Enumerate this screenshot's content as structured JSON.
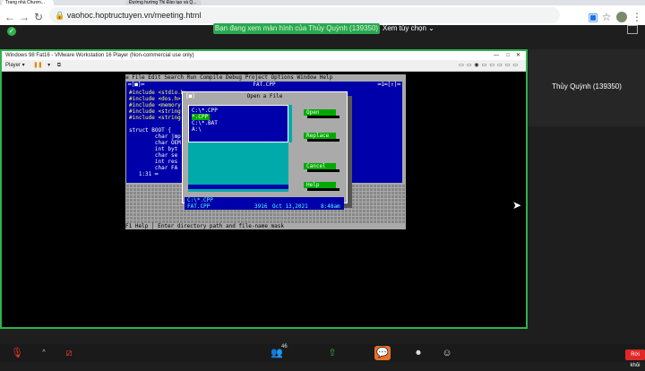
{
  "browser": {
    "url": "vaohoc.hoptructuyen.vn/meeting.html",
    "tabs": [
      "Trang nhà Chươn...",
      "Đường hướng Thi Đào tạo và Q..."
    ]
  },
  "zoom": {
    "share_banner": "Bạn đang xem màn hình của Thủy Quỳnh (139350)",
    "view_options": "Xem tùy chọn ⌄",
    "participant_name": "Thủy Quỳnh (139350)",
    "participant_count": "46",
    "leave_label": "Rời khỏi"
  },
  "vm": {
    "title": "Windows 98 Fat16 - VMware Workstation 16 Player (Non-commercial use only)",
    "player_menu": "Player ▾"
  },
  "dos": {
    "menu": "≡  File  Edit  Search  Run  Compile  Debug  Project  Options     Window  Help",
    "editor_title": "FAT.CPP",
    "editor_left_marker": "═[■]═",
    "editor_right_marker": "═1═[↑]═",
    "code": [
      "#include <stdio.h>",
      "#include <dos.h>",
      "#include <memory.h>",
      "#include <string.h>",
      "#include <string.h>",
      "",
      "struct BOOT {",
      "        char jmp",
      "        char OEM",
      "        int byt",
      "        char se",
      "        int res",
      "        char FA",
      "   1:31 ═"
    ],
    "dialog": {
      "title": "Open a File",
      "entries": [
        "C:\\*.CPP",
        "*.CPP",
        "C:\\*.BAT",
        "A:\\"
      ],
      "buttons": [
        "Open",
        "Replace",
        "Cancel",
        "Help"
      ],
      "info_path": "C:\\*.CPP",
      "info_file": "FAT.CPP",
      "info_size": "3916",
      "info_date": "Oct 13,2021",
      "info_time": "8:48am"
    },
    "status": "F1 Help │ Enter directory path and file-name mask"
  }
}
